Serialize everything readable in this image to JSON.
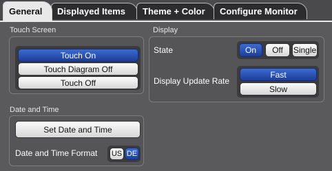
{
  "tabs": [
    {
      "label": "General"
    },
    {
      "label": "Displayed Items"
    },
    {
      "label": "Theme + Color"
    },
    {
      "label": "Configure Monitor"
    }
  ],
  "touch_screen": {
    "title": "Touch Screen",
    "options": [
      "Touch On",
      "Touch Diagram Off",
      "Touch Off"
    ],
    "selected": "Touch On"
  },
  "display": {
    "title": "Display",
    "state": {
      "label": "State",
      "options": [
        "On",
        "Off",
        "Single"
      ],
      "selected": "On"
    },
    "update_rate": {
      "label": "Display Update Rate",
      "options": [
        "Fast",
        "Slow"
      ],
      "selected": "Fast"
    }
  },
  "date_time": {
    "title": "Date and Time",
    "set_button": "Set Date and Time",
    "format_label": "Date and Time Format",
    "format_options": [
      "US",
      "DE"
    ],
    "format_selected": "DE"
  },
  "colors": {
    "accent": "#2a55b8",
    "panel": "#5a5a5c",
    "tab_active": "#e9e9ea"
  }
}
